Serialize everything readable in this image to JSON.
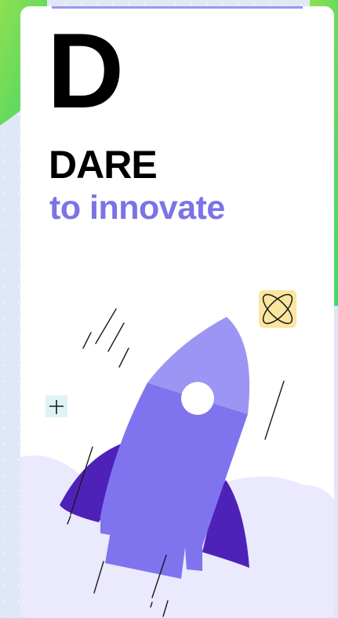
{
  "card": {
    "letter": "D",
    "headline": "DARE",
    "subline": "to innovate"
  },
  "colors": {
    "accent": "#7b73e6",
    "rocket_body": "#7f74ee",
    "rocket_nose": "#9d95f4",
    "rocket_fins": "#4e22b8",
    "cloud": "#ebe9fd",
    "atom_bg": "#fbe6a0",
    "plus_bg": "#dff3f6",
    "green_band": "#6fdc48"
  },
  "icons": [
    "rocket-illustration",
    "atom-icon",
    "plus-icon",
    "speed-lines"
  ]
}
